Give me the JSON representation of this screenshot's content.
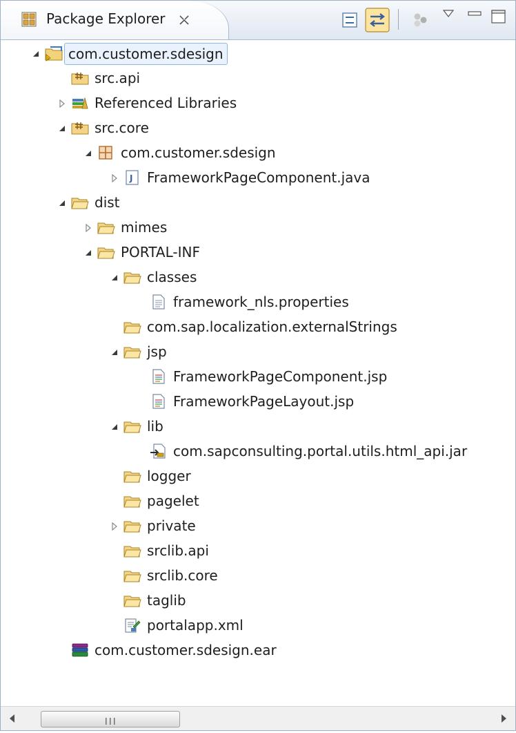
{
  "view": {
    "title": "Package Explorer",
    "close_glyph": "✕",
    "toolbar": {
      "collapse_all_icon": "collapse-all-icon",
      "link_editor_icon": "link-with-editor-icon",
      "filter_icon": "filter-icon",
      "view_menu_icon": "view-menu-icon",
      "minimize_icon": "minimize-icon",
      "maximize_icon": "maximize-icon"
    }
  },
  "tree": [
    {
      "label": "com.customer.sdesign",
      "icon": "project-icon",
      "level": 0,
      "expander": "expanded",
      "selected": true
    },
    {
      "label": "src.api",
      "icon": "source-folder-icon",
      "level": 1,
      "expander": "none"
    },
    {
      "label": "Referenced Libraries",
      "icon": "libraries-icon",
      "level": 1,
      "expander": "collapsed"
    },
    {
      "label": "src.core",
      "icon": "source-folder-icon",
      "level": 1,
      "expander": "expanded"
    },
    {
      "label": "com.customer.sdesign",
      "icon": "package-icon",
      "level": 2,
      "expander": "expanded"
    },
    {
      "label": "FrameworkPageComponent.java",
      "icon": "java-file-icon",
      "level": 3,
      "expander": "collapsed"
    },
    {
      "label": "dist",
      "icon": "folder-icon",
      "level": 1,
      "expander": "expanded"
    },
    {
      "label": "mimes",
      "icon": "folder-icon",
      "level": 2,
      "expander": "collapsed"
    },
    {
      "label": "PORTAL-INF",
      "icon": "folder-icon",
      "level": 2,
      "expander": "expanded"
    },
    {
      "label": "classes",
      "icon": "folder-icon",
      "level": 3,
      "expander": "expanded"
    },
    {
      "label": "framework_nls.properties",
      "icon": "text-file-icon",
      "level": 4,
      "expander": "none"
    },
    {
      "label": "com.sap.localization.externalStrings",
      "icon": "folder-icon",
      "level": 3,
      "expander": "none"
    },
    {
      "label": "jsp",
      "icon": "folder-icon",
      "level": 3,
      "expander": "expanded"
    },
    {
      "label": "FrameworkPageComponent.jsp",
      "icon": "jsp-file-icon",
      "level": 4,
      "expander": "none"
    },
    {
      "label": "FrameworkPageLayout.jsp",
      "icon": "jsp-file-icon",
      "level": 4,
      "expander": "none"
    },
    {
      "label": "lib",
      "icon": "folder-icon",
      "level": 3,
      "expander": "expanded"
    },
    {
      "label": "com.sapconsulting.portal.utils.html_api.jar",
      "icon": "jar-file-icon",
      "level": 4,
      "expander": "none"
    },
    {
      "label": "logger",
      "icon": "folder-icon",
      "level": 3,
      "expander": "none"
    },
    {
      "label": "pagelet",
      "icon": "folder-icon",
      "level": 3,
      "expander": "none"
    },
    {
      "label": "private",
      "icon": "folder-icon",
      "level": 3,
      "expander": "collapsed"
    },
    {
      "label": "srclib.api",
      "icon": "folder-icon",
      "level": 3,
      "expander": "none"
    },
    {
      "label": "srclib.core",
      "icon": "folder-icon",
      "level": 3,
      "expander": "none"
    },
    {
      "label": "taglib",
      "icon": "folder-icon",
      "level": 3,
      "expander": "none"
    },
    {
      "label": "portalapp.xml",
      "icon": "xml-file-icon",
      "level": 3,
      "expander": "none"
    },
    {
      "label": "com.customer.sdesign.ear",
      "icon": "archive-icon",
      "level": 1,
      "expander": "none"
    }
  ],
  "scrollbar": {
    "left_arrow_icon": "scroll-left-icon",
    "right_arrow_icon": "scroll-right-icon",
    "grip_glyph": "III"
  }
}
